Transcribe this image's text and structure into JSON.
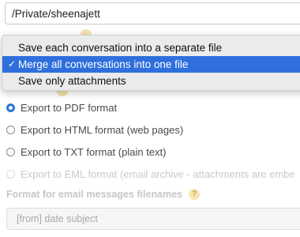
{
  "path": {
    "value": "/Private/sheenajett"
  },
  "dropdown": {
    "items": [
      {
        "label": "Save each conversation into a separate file",
        "selected": false
      },
      {
        "label": "Merge all conversations into one file",
        "selected": true
      },
      {
        "label": "Save only attachments",
        "selected": false
      }
    ],
    "check_glyph": "✓"
  },
  "export_options": [
    {
      "label": "Export to PDF format",
      "checked": true,
      "disabled": false
    },
    {
      "label": "Export to HTML format (web pages)",
      "checked": false,
      "disabled": false
    },
    {
      "label": "Export to TXT format (plain text)",
      "checked": false,
      "disabled": false
    },
    {
      "label": "Export to EML format (email archive - attachments are embe",
      "checked": false,
      "disabled": true
    }
  ],
  "filename_section": {
    "label": "Format for email messages filenames",
    "help_icon": "?",
    "value": "[from] date subject"
  },
  "colors": {
    "accent": "#2b74d8",
    "menu_selected": "#2f6fdd",
    "help_badge": "#f8e5b3"
  }
}
